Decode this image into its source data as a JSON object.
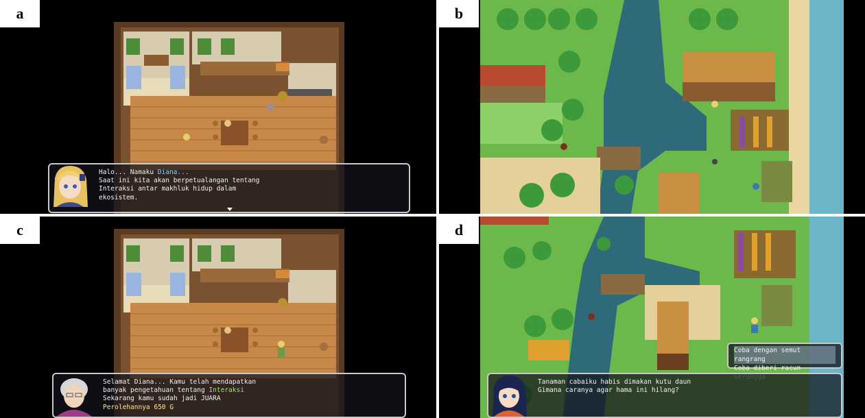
{
  "panels": {
    "a": {
      "label": "a",
      "dialog": {
        "prefix_line1": "Halo... Namaku ",
        "name": "Diana...",
        "line2": "Saat ini kita akan berpetualangan tentang",
        "line3": "Interaksi antar makhluk hidup dalam",
        "line4": "ekosistem."
      }
    },
    "b": {
      "label": "b"
    },
    "c": {
      "label": "c",
      "dialog": {
        "line1": "Selamat Diana... Kamu telah mendapatkan",
        "line2_prefix": "banyak pengetahuan tentang ",
        "line2_highlight": "Interaksi",
        "line3": "Sekarang kamu sudah jadi JUARA",
        "line4": "Perolehannya 650 G"
      }
    },
    "d": {
      "label": "d",
      "dialog": {
        "line1": "Tanaman cabaiku habis dimakan kutu daun",
        "line2": "Gimana caranya agar hama ini hilang?"
      },
      "choices": [
        "Coba dengan semut rangrang",
        "Coba diberi racun serangga"
      ]
    }
  }
}
